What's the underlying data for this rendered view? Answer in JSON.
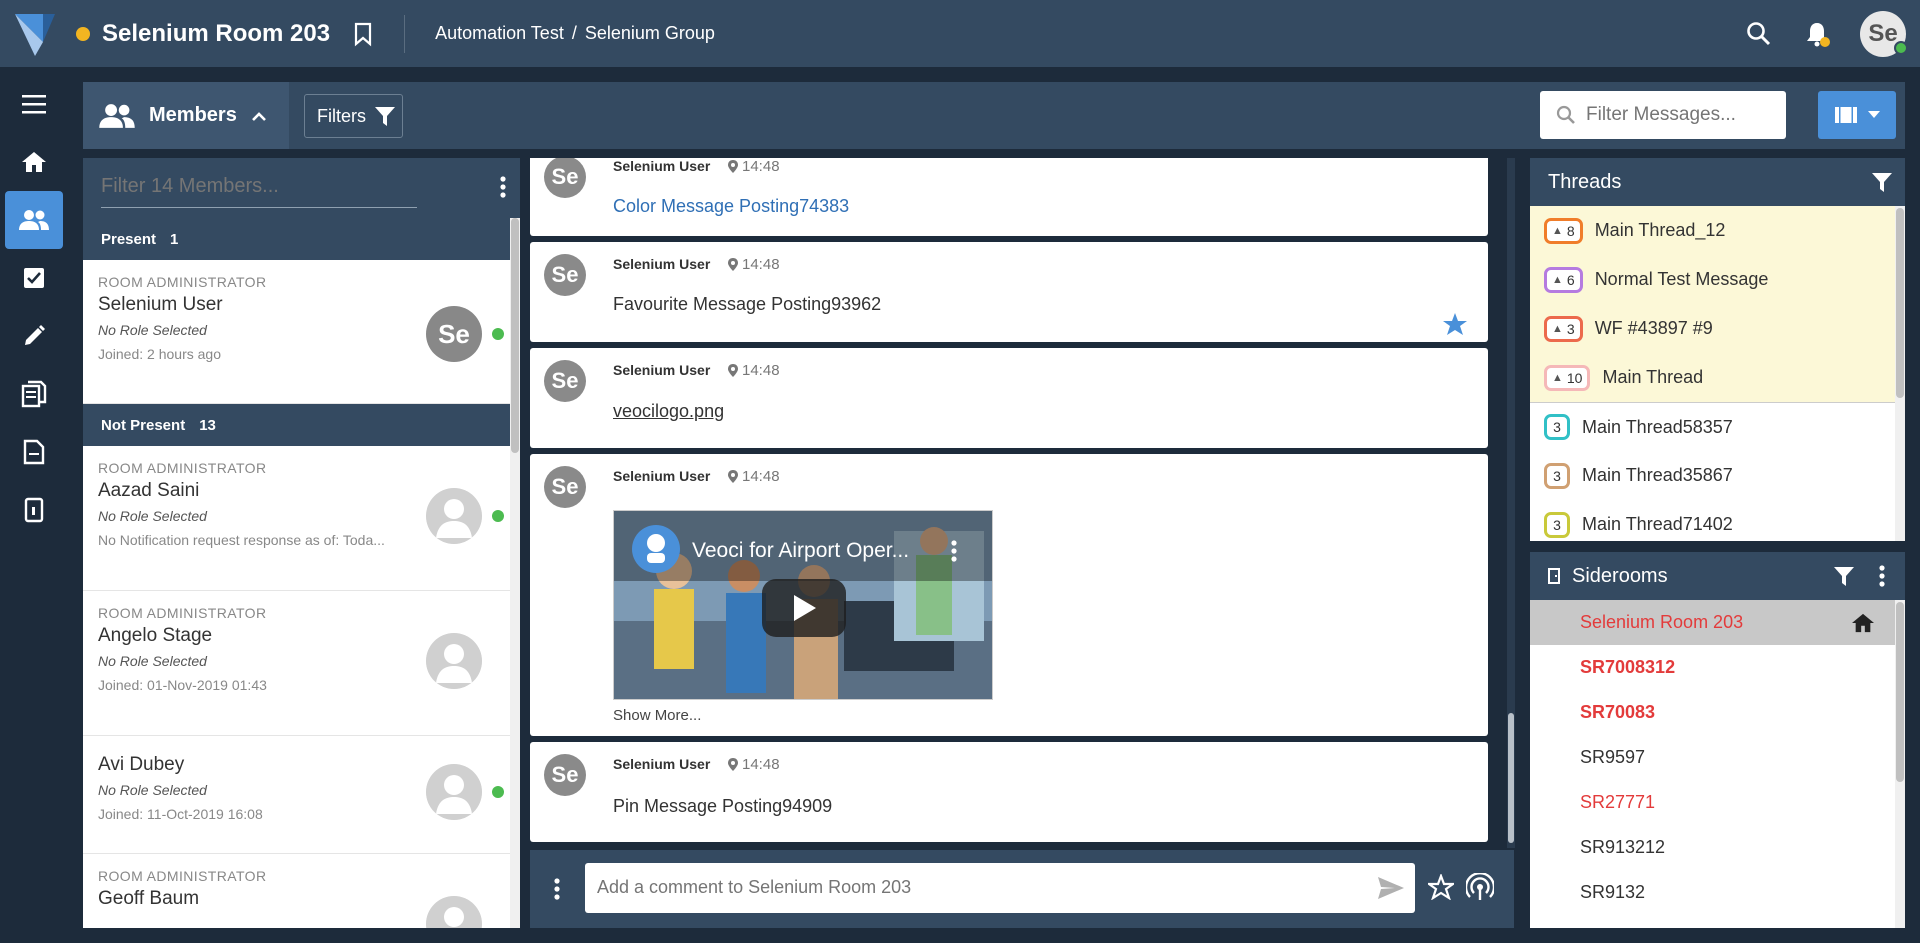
{
  "header": {
    "room_title": "Selenium Room 203",
    "breadcrumb": [
      "Automation Test",
      "/",
      "Selenium Group"
    ],
    "avatar_text": "Se"
  },
  "toolbar": {
    "members_label": "Members",
    "filters_label": "Filters",
    "filter_messages_placeholder": "Filter Messages..."
  },
  "members": {
    "filter_placeholder": "Filter 14 Members...",
    "present": {
      "label": "Present",
      "count": "1"
    },
    "not_present": {
      "label": "Not Present",
      "count": "13"
    },
    "present_members": [
      {
        "role": "ROOM ADMINISTRATOR",
        "name": "Selenium User",
        "role_selected": "No Role Selected",
        "joined": "Joined: 2 hours ago"
      }
    ],
    "absent_members": [
      {
        "role": "ROOM ADMINISTRATOR",
        "name": "Aazad Saini",
        "role_selected": "No Role Selected",
        "joined": "No Notification request response as of: Toda..."
      },
      {
        "role": "ROOM ADMINISTRATOR",
        "name": "Angelo Stage",
        "role_selected": "No Role Selected",
        "joined": "Joined: 01-Nov-2019 01:43"
      },
      {
        "role": "",
        "name": "Avi Dubey",
        "role_selected": "No Role Selected",
        "joined": "Joined: 11-Oct-2019 16:08"
      },
      {
        "role": "ROOM ADMINISTRATOR",
        "name": "Geoff Baum",
        "role_selected": "",
        "joined": ""
      }
    ]
  },
  "messages": [
    {
      "author": "Selenium User",
      "time": "14:48",
      "text": "Color Message Posting74383"
    },
    {
      "author": "Selenium User",
      "time": "14:48",
      "text": "Favourite Message Posting93962"
    },
    {
      "author": "Selenium User",
      "time": "14:48",
      "text": "veocilogo.png"
    },
    {
      "author": "Selenium User",
      "time": "14:48",
      "video_title": "Veoci for Airport Oper...",
      "show_more": "Show More..."
    },
    {
      "author": "Selenium User",
      "time": "14:48",
      "text": "Pin Message Posting94909"
    }
  ],
  "composer": {
    "placeholder": "Add a comment to Selenium Room 203"
  },
  "threads": {
    "title": "Threads",
    "pinned": [
      {
        "count": "8",
        "name": "Main Thread_12",
        "color": "#f07d2a"
      },
      {
        "count": "6",
        "name": "Normal Test Message",
        "color": "#b57be0"
      },
      {
        "count": "3",
        "name": "WF #43897 #9",
        "color": "#ec6a4c"
      },
      {
        "count": "10",
        "name": "Main Thread",
        "color": "#f5b8b8"
      }
    ],
    "unpinned": [
      {
        "count": "3",
        "name": "Main Thread58357",
        "color": "#31c0c6"
      },
      {
        "count": "3",
        "name": "Main Thread35867",
        "color": "#d0a072"
      },
      {
        "count": "3",
        "name": "Main Thread71402",
        "color": "#c9c93a"
      }
    ]
  },
  "siderooms": {
    "title": "Siderooms",
    "items": [
      {
        "name": "Selenium Room 203"
      },
      {
        "name": "SR7008312"
      },
      {
        "name": "SR70083"
      },
      {
        "name": "SR9597"
      },
      {
        "name": "SR27771"
      },
      {
        "name": "SR913212"
      },
      {
        "name": "SR9132"
      }
    ]
  },
  "colors": {
    "accent": "#4a90d9",
    "header": "#344a61",
    "background": "#1d2b3b",
    "online": "#4cbb50",
    "red": "#e33b3b"
  }
}
